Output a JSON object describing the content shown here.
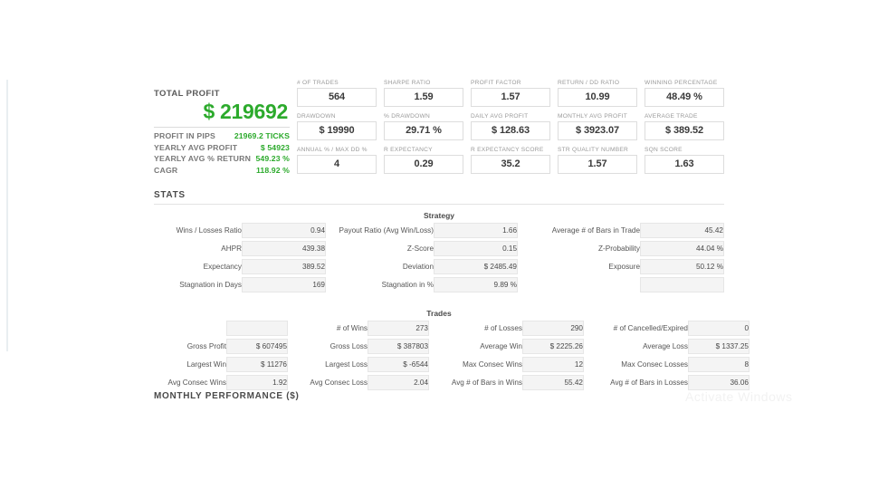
{
  "summary": {
    "total_profit_label": "TOTAL PROFIT",
    "total_profit_value": "$ 219692",
    "accent_green": "#2caa2c",
    "rows": [
      {
        "key": "PROFIT IN PIPS",
        "value": "21969.2 TICKS"
      },
      {
        "key": "YEARLY AVG PROFIT",
        "value": "$ 54923"
      },
      {
        "key": "YEARLY AVG % RETURN",
        "value": "549.23 %"
      },
      {
        "key": "CAGR",
        "value": "118.92 %"
      }
    ]
  },
  "metrics": [
    {
      "label": "# OF TRADES",
      "value": "564"
    },
    {
      "label": "SHARPE RATIO",
      "value": "1.59"
    },
    {
      "label": "PROFIT FACTOR",
      "value": "1.57"
    },
    {
      "label": "RETURN / DD RATIO",
      "value": "10.99"
    },
    {
      "label": "WINNING PERCENTAGE",
      "value": "48.49 %"
    },
    {
      "label": "DRAWDOWN",
      "value": "$ 19990"
    },
    {
      "label": "% DRAWDOWN",
      "value": "29.71 %"
    },
    {
      "label": "DAILY AVG PROFIT",
      "value": "$ 128.63"
    },
    {
      "label": "MONTHLY AVG PROFIT",
      "value": "$ 3923.07"
    },
    {
      "label": "AVERAGE TRADE",
      "value": "$ 389.52"
    },
    {
      "label": "ANNUAL % / MAX DD %",
      "value": "4"
    },
    {
      "label": "R EXPECTANCY",
      "value": "0.29"
    },
    {
      "label": "R EXPECTANCY SCORE",
      "value": "35.2"
    },
    {
      "label": "STR QUALITY NUMBER",
      "value": "1.57"
    },
    {
      "label": "SQN SCORE",
      "value": "1.63"
    }
  ],
  "stats": {
    "heading": "STATS",
    "strategy": {
      "caption": "Strategy",
      "rows": [
        [
          {
            "label": "Wins / Losses Ratio",
            "value": "0.94"
          },
          {
            "label": "Payout Ratio (Avg Win/Loss)",
            "value": "1.66"
          },
          {
            "label": "Average # of Bars in Trade",
            "value": "45.42"
          }
        ],
        [
          {
            "label": "AHPR",
            "value": "439.38"
          },
          {
            "label": "Z-Score",
            "value": "0.15"
          },
          {
            "label": "Z-Probability",
            "value": "44.04 %"
          }
        ],
        [
          {
            "label": "Expectancy",
            "value": "389.52"
          },
          {
            "label": "Deviation",
            "value": "$ 2485.49"
          },
          {
            "label": "Exposure",
            "value": "50.12 %"
          }
        ],
        [
          {
            "label": "Stagnation in Days",
            "value": "169"
          },
          {
            "label": "Stagnation in %",
            "value": "9.89 %"
          },
          {
            "label": "",
            "value": ""
          }
        ]
      ]
    },
    "trades": {
      "caption": "Trades",
      "rows": [
        [
          {
            "label": "",
            "value": ""
          },
          {
            "label": "# of Wins",
            "value": "273"
          },
          {
            "label": "# of Losses",
            "value": "290"
          },
          {
            "label": "# of Cancelled/Expired",
            "value": "0"
          }
        ],
        [
          {
            "label": "Gross Profit",
            "value": "$ 607495"
          },
          {
            "label": "Gross Loss",
            "value": "$ 387803"
          },
          {
            "label": "Average Win",
            "value": "$ 2225.26"
          },
          {
            "label": "Average Loss",
            "value": "$ 1337.25"
          }
        ],
        [
          {
            "label": "Largest Win",
            "value": "$ 11276"
          },
          {
            "label": "Largest Loss",
            "value": "$ -6544"
          },
          {
            "label": "Max Consec Wins",
            "value": "12"
          },
          {
            "label": "Max Consec Losses",
            "value": "8"
          }
        ],
        [
          {
            "label": "Avg Consec Wins",
            "value": "1.92"
          },
          {
            "label": "Avg Consec Loss",
            "value": "2.04"
          },
          {
            "label": "Avg # of Bars in Wins",
            "value": "55.42"
          },
          {
            "label": "Avg # of Bars in Losses",
            "value": "36.06"
          }
        ]
      ]
    }
  },
  "monthly_performance": {
    "title": "MONTHLY PERFORMANCE ($)"
  },
  "watermark": {
    "line1": "Activate Windows"
  }
}
